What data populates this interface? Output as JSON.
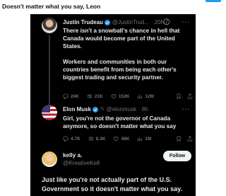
{
  "post": {
    "caption": "Doesn't matter what you say, Leon"
  },
  "tweets": [
    {
      "author_name": "Justin Trudeau",
      "handle": "@JustinTrud...",
      "time": "· 20h",
      "text_paragraphs": [
        "There isn't a snowball's chance in hell that Canada would become part of the United States.",
        "Workers and communities in both our countries benefit from being each other's biggest trading and security partner."
      ],
      "stats": {
        "replies": "24K",
        "reposts": "21K",
        "likes": "152K",
        "views": "12M"
      }
    },
    {
      "author_name": "Elon Musk",
      "handle": "@elonmusk",
      "time": "· 8h",
      "text": "Girl, you're not the governor of Canada anymore, so doesn't matter what you say",
      "stats": {
        "replies": "4.7K",
        "reposts": "8.3K",
        "likes": "48K",
        "views": "1M"
      }
    }
  ],
  "reply_account": {
    "name": "kelly a.",
    "handle": "@KreativeKell",
    "follow_label": "Follow",
    "text": "Just like you're not actually part of the U.S. Government so it doesn't matter what you say."
  },
  "colors": {
    "background": "#000000",
    "verified": "#1d9bf0",
    "muted": "#71767b"
  }
}
